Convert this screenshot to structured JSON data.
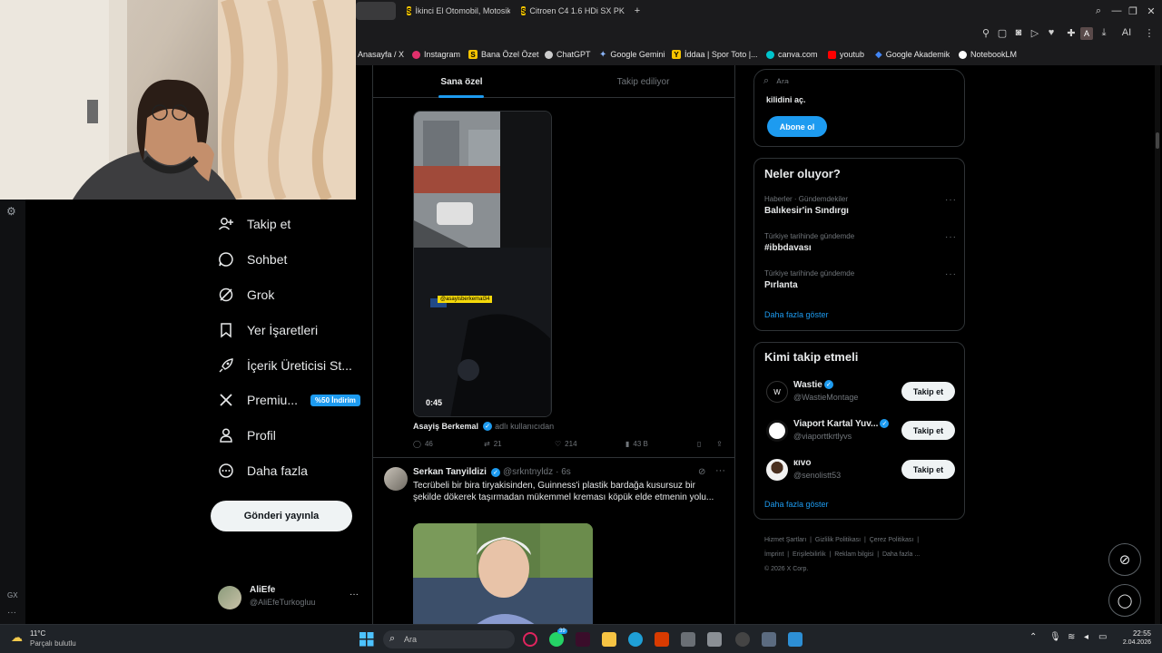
{
  "browser": {
    "tabs": [
      {
        "label": ""
      },
      {
        "label": "İkinci El Otomobil, Motosik"
      },
      {
        "label": "Citroen C4 1.6 HDi SX PK"
      }
    ],
    "new_tab": "+",
    "bookmarks": [
      {
        "label": "Anasayfa / X",
        "color": "#ffffff"
      },
      {
        "label": "Instagram",
        "color": "#e1306c"
      },
      {
        "label": "Bana Özel Özet",
        "color": "#f5c400"
      },
      {
        "label": "ChatGPT",
        "color": "#cccccc"
      },
      {
        "label": "Google Gemini",
        "color": "#8ab4f8"
      },
      {
        "label": "İddaa | Spor Toto |...",
        "color": "#f5c400"
      },
      {
        "label": "canva.com",
        "color": "#00c4cc"
      },
      {
        "label": "youtub",
        "color": "#ff0000"
      },
      {
        "label": "Google Akademik",
        "color": "#4285f4"
      },
      {
        "label": "NotebookLM",
        "color": "#ffffff"
      }
    ],
    "profile_letter": "A",
    "ai_label": "AI"
  },
  "webcam": {
    "description_icon": "person-on-webcam"
  },
  "sidebar": {
    "items": [
      {
        "label": "Takip et",
        "icon": "add-user-icon",
        "glyph": "👤"
      },
      {
        "label": "Sohbet",
        "icon": "chat-icon",
        "glyph": "💬"
      },
      {
        "label": "Grok",
        "icon": "grok-icon",
        "glyph": "⊘"
      },
      {
        "label": "Yer İşaretleri",
        "icon": "bookmark-icon",
        "glyph": "🔖"
      },
      {
        "label": "İçerik Üreticisi St...",
        "icon": "rocket-icon",
        "glyph": "🚀"
      },
      {
        "label": "Premiu...",
        "icon": "x-logo-icon",
        "glyph": "𝕏",
        "badge": "%50 İndirim"
      },
      {
        "label": "Profil",
        "icon": "profile-icon",
        "glyph": "👤"
      },
      {
        "label": "Daha fazla",
        "icon": "more-circle-icon",
        "glyph": "⋯"
      }
    ],
    "post_button": "Gönderi yayınla",
    "account": {
      "name": "AliEfe",
      "handle": "@AliEfeTurkogluu",
      "more": "···"
    }
  },
  "feed": {
    "tabs": [
      {
        "label": "Sana özel",
        "active": true
      },
      {
        "label": "Takip ediliyor",
        "active": false
      }
    ],
    "post1": {
      "video_tag": "@asayisberkemal34",
      "duration": "0:45",
      "source_name": "Asayiş Berkemal",
      "source_suffix": "adlı kullanıcıdan",
      "replies": "46",
      "reposts": "21",
      "likes": "214",
      "views": "43 B"
    },
    "post2": {
      "author": "Serkan Tanyildizi",
      "handle": "@srkntnyldz",
      "time": "· 6s",
      "text": "Tecrübeli bir bira tiryakisinden, Guinness'i plastik bardağa kusursuz bir şekilde dökerek taşırmadan mükemmel kreması köpük elde etmenin yolu..."
    }
  },
  "right": {
    "search_placeholder": "Ara",
    "premium": {
      "text": "kilidini aç.",
      "button": "Abone ol"
    },
    "trends": {
      "title": "Neler oluyor?",
      "items": [
        {
          "meta": "Haberler · Gündemdekiler",
          "title": "Balıkesir'in Sındırgı"
        },
        {
          "meta": "Türkiye tarihinde gündemde",
          "title": "#ibbdavası"
        },
        {
          "meta": "Türkiye tarihinde gündemde",
          "title": "Pırlanta"
        }
      ],
      "show_more": "Daha fazla göster"
    },
    "who_to_follow": {
      "title": "Kimi takip etmeli",
      "users": [
        {
          "name": "Wastie",
          "handle": "@WastieMontage",
          "verified": true,
          "button": "Takip et"
        },
        {
          "name": "Viaport Kartal Yuv...",
          "handle": "@viaporttkrtlyvs",
          "verified": true,
          "button": "Takip et"
        },
        {
          "name": "кıvo",
          "handle": "@senolistt53",
          "verified": false,
          "button": "Takip et"
        }
      ],
      "show_more": "Daha fazla göster"
    },
    "footer": {
      "links": [
        "Hizmet Şartları",
        "Gizlilik Politikası",
        "Çerez Politikası",
        "İmprint",
        "Erişilebilirlik",
        "Reklam bilgisi",
        "Daha fazla ..."
      ],
      "copyright": "© 2026 X Corp."
    }
  },
  "left_edge": {
    "gx_label": "GX",
    "more": "···"
  },
  "taskbar": {
    "weather_temp": "11°C",
    "weather_desc": "Parçalı bulutlu",
    "search_placeholder": "Ara",
    "whatsapp_badge": "39",
    "time": "22:55",
    "date": "2.04.2026"
  }
}
